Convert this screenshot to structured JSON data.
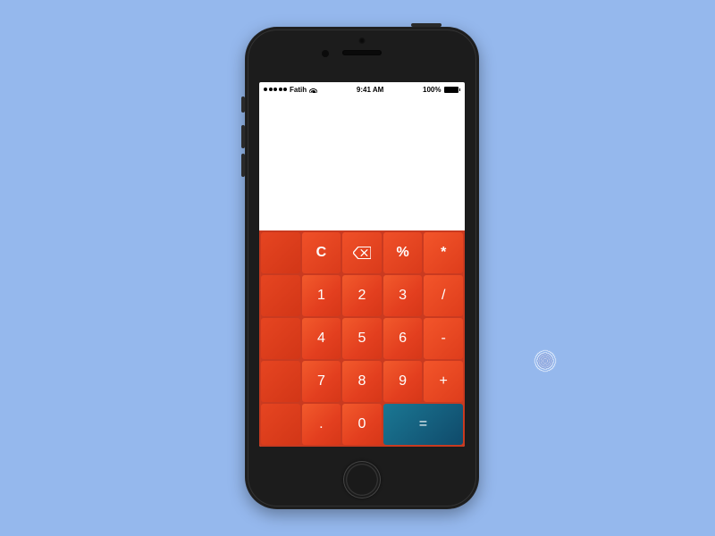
{
  "statusbar": {
    "carrier": "Fatih",
    "time": "9:41 AM",
    "battery_pct": "100%"
  },
  "keypad": {
    "row1": {
      "clear": "C",
      "backspace_icon": "backspace-icon",
      "percent": "%",
      "multiply": "*"
    },
    "row2": {
      "n1": "1",
      "n2": "2",
      "n3": "3",
      "divide": "/"
    },
    "row3": {
      "n4": "4",
      "n5": "5",
      "n6": "6",
      "minus": "-"
    },
    "row4": {
      "n7": "7",
      "n8": "8",
      "n9": "9",
      "plus": "+"
    },
    "row5": {
      "dot": ".",
      "n0": "0",
      "equals": "="
    }
  },
  "colors": {
    "background": "#95b8ed",
    "key_accent": "#e8441f",
    "equals": "#176b86"
  }
}
